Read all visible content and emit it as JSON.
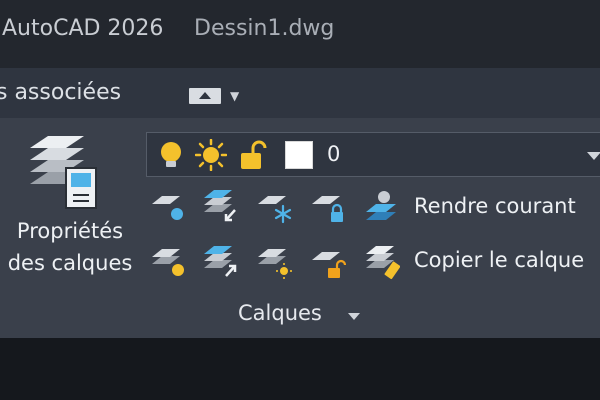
{
  "titlebar": {
    "app_title": "AutoCAD 2026",
    "document_title": "Dessin1.dwg"
  },
  "tabstrip": {
    "tab_label": "s associées"
  },
  "layers_panel": {
    "big_button": {
      "label_line1": "Propriétés",
      "label_line2": "des calques",
      "icon": "layer-properties-icon"
    },
    "layer_dropdown": {
      "current_layer": "0",
      "icons": [
        "bulb-on-icon",
        "sun-thaw-icon",
        "unlock-icon"
      ],
      "color_swatch": "#ffffff"
    },
    "commands": {
      "rendre_courant": "Rendre courant",
      "copier_calque": "Copier le calque"
    },
    "panel_title": "Calques"
  },
  "colors": {
    "accent_blue": "#4fb3e8",
    "accent_yellow": "#f4c12c",
    "accent_orange": "#f0a21c"
  }
}
